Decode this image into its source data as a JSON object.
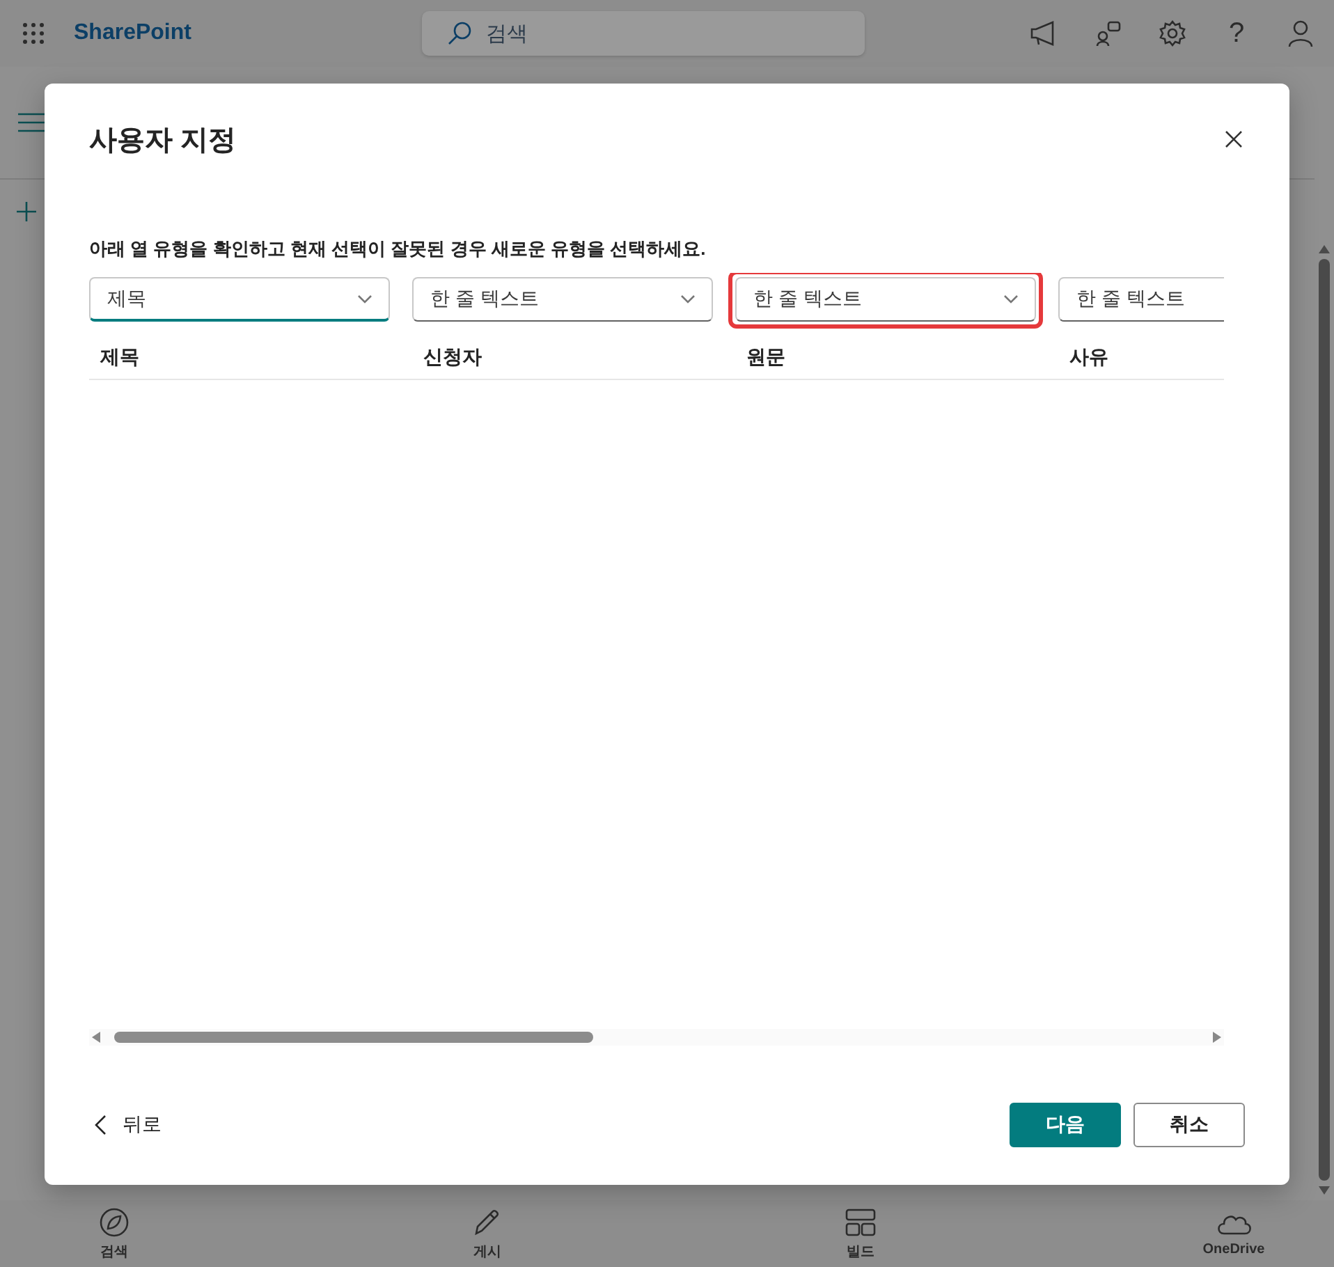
{
  "app": {
    "name": "SharePoint",
    "search_placeholder": "검색",
    "help_glyph": "?"
  },
  "dialog": {
    "title": "사용자 지정",
    "instruction": "아래 열 유형을 확인하고 현재 선택이 잘못된 경우 새로운 유형을 선택하세요.",
    "columns": [
      {
        "type": "제목",
        "header": "제목",
        "focused": true,
        "highlighted": false
      },
      {
        "type": "한 줄 텍스트",
        "header": "신청자",
        "focused": false,
        "highlighted": false
      },
      {
        "type": "한 줄 텍스트",
        "header": "원문",
        "focused": false,
        "highlighted": true
      },
      {
        "type": "한 줄 텍스트",
        "header": "사유",
        "focused": false,
        "highlighted": false
      }
    ],
    "back": "뒤로",
    "primary": "다음",
    "cancel": "취소"
  },
  "bottom_nav": [
    {
      "kind": "compass",
      "label": "검색"
    },
    {
      "kind": "pen",
      "label": "게시"
    },
    {
      "kind": "layout",
      "label": "빌드"
    },
    {
      "kind": "cloud",
      "label": "OneDrive"
    }
  ]
}
